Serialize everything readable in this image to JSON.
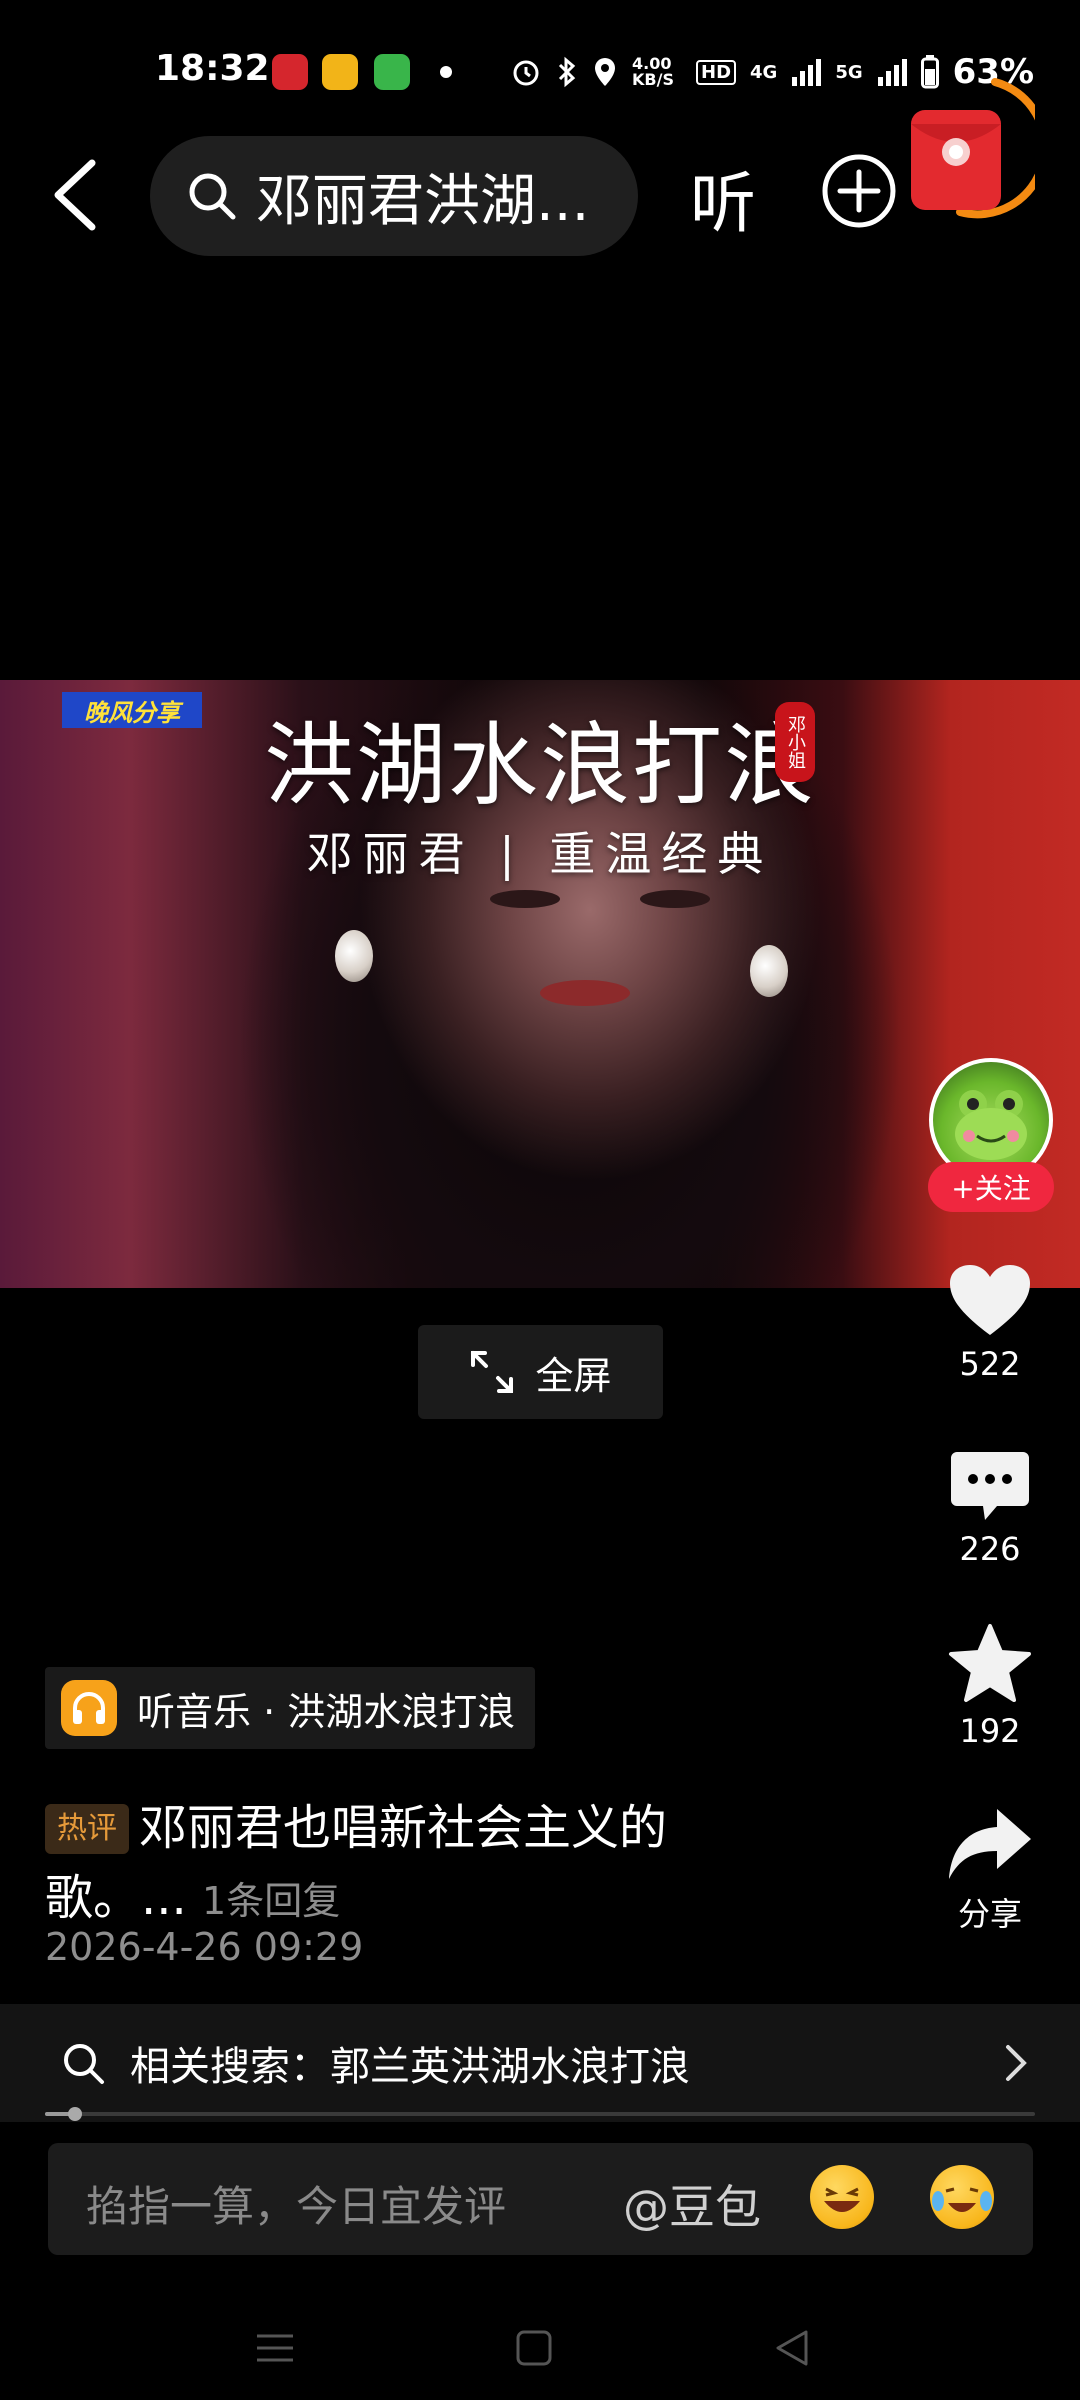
{
  "status_bar": {
    "time": "18:32",
    "network_speed": "4.00 KB/S",
    "hd_badge": "HD",
    "signal_1": "4G",
    "signal_2": "5G",
    "battery": "63%"
  },
  "top_bar": {
    "search_text": "邓丽君洪湖...",
    "listen_label": "听"
  },
  "video": {
    "badge": "晚风分享",
    "title": "洪湖水浪打浪",
    "seal": "邓小姐",
    "subtitle": "邓丽君 | 重温经典"
  },
  "right_rail": {
    "follow_label": "+关注",
    "likes": "522",
    "comments": "226",
    "favorites": "192",
    "share_label": "分享"
  },
  "fullscreen_label": "全屏",
  "music": {
    "label": "听音乐 · 洪湖水浪打浪"
  },
  "hot_comment": {
    "tag": "热评",
    "text": "邓丽君也唱新社会主义的歌。...",
    "replies": "1条回复",
    "time": "2026-4-26 09:29"
  },
  "related_search": {
    "label": "相关搜索：郭兰英洪湖水浪打浪"
  },
  "progress": {
    "fraction": 0.03
  },
  "comment_box": {
    "placeholder": "掐指一算，今日宜发评",
    "mention": "@豆包"
  },
  "colors": {
    "accent_red": "#f0273f",
    "music_orange": "#f7a21a",
    "hot_tag": "#e59a3a"
  }
}
